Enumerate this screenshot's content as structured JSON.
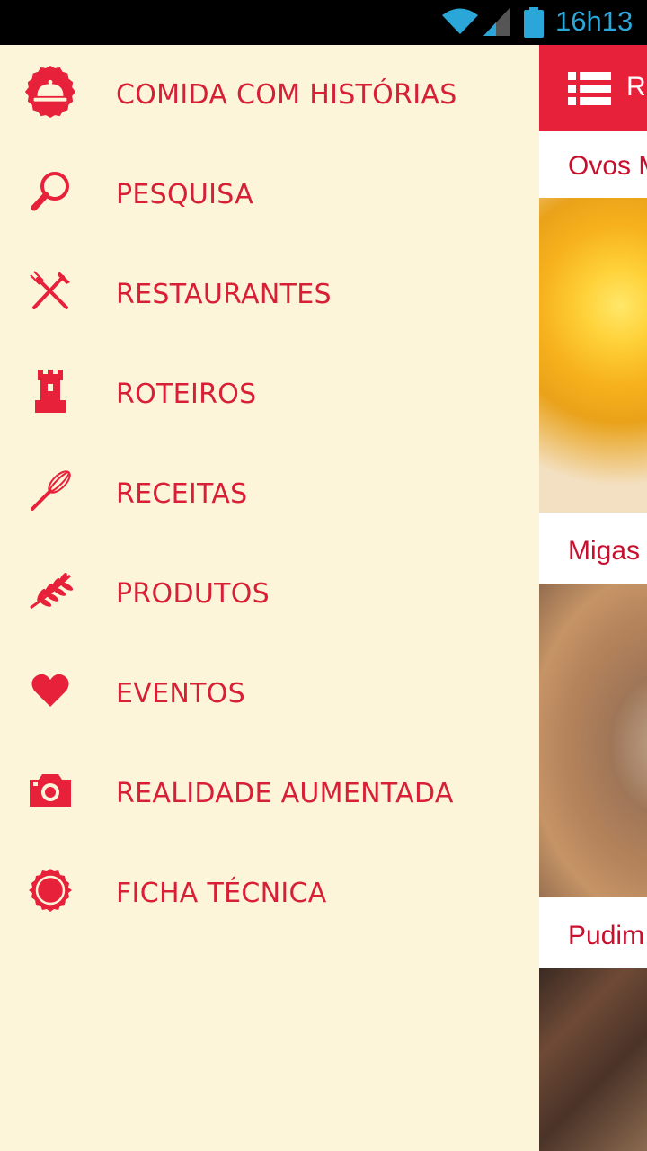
{
  "status_bar": {
    "time": "16h13",
    "icons": [
      "wifi-icon",
      "signal-icon",
      "battery-icon"
    ],
    "time_color": "#2aa7d8"
  },
  "theme": {
    "accent": "#e8213b",
    "drawer_bg": "#fdf5da",
    "text": "#d71f36"
  },
  "background_screen": {
    "appbar_title_partial": "R",
    "cards": [
      {
        "title": "Ovos M"
      },
      {
        "title": "Migas"
      },
      {
        "title": "Pudim"
      }
    ]
  },
  "drawer": {
    "items": [
      {
        "label": "COMIDA COM HISTÓRIAS",
        "icon": "cloche-icon"
      },
      {
        "label": "PESQUISA",
        "icon": "search-icon"
      },
      {
        "label": "RESTAURANTES",
        "icon": "fork-knife-icon"
      },
      {
        "label": "ROTEIROS",
        "icon": "tower-icon"
      },
      {
        "label": "RECEITAS",
        "icon": "whisk-icon"
      },
      {
        "label": "PRODUTOS",
        "icon": "wheat-icon"
      },
      {
        "label": "EVENTOS",
        "icon": "heart-icon"
      },
      {
        "label": "REALIDADE AUMENTADA",
        "icon": "camera-icon"
      },
      {
        "label": "FICHA TÉCNICA",
        "icon": "badge-icon"
      }
    ]
  }
}
